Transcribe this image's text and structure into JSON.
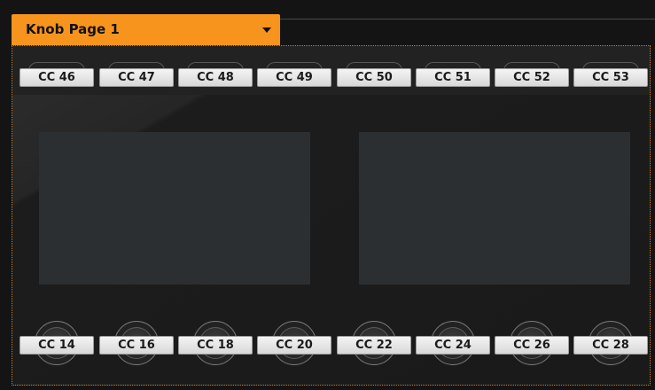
{
  "page_selector": {
    "label": "Knob Page 1",
    "icon": "dropdown-arrow-icon"
  },
  "top_controls": [
    "CC 46",
    "CC 47",
    "CC 48",
    "CC 49",
    "CC 50",
    "CC 51",
    "CC 52",
    "CC 53"
  ],
  "bottom_controls": [
    "CC 14",
    "CC 16",
    "CC 18",
    "CC 20",
    "CC 22",
    "CC 24",
    "CC 26",
    "CC 28"
  ],
  "colors": {
    "accent": "#f7941d",
    "pad": "#2b2f31",
    "background": "#141414"
  }
}
